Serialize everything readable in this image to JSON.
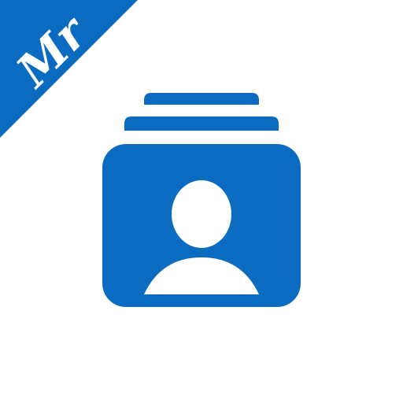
{
  "icon": {
    "name": "contacts-stack-icon",
    "brand_color": "#0A6BC1",
    "background_color": "#FFFFFF"
  },
  "corner_banner": {
    "label": "Mr"
  }
}
